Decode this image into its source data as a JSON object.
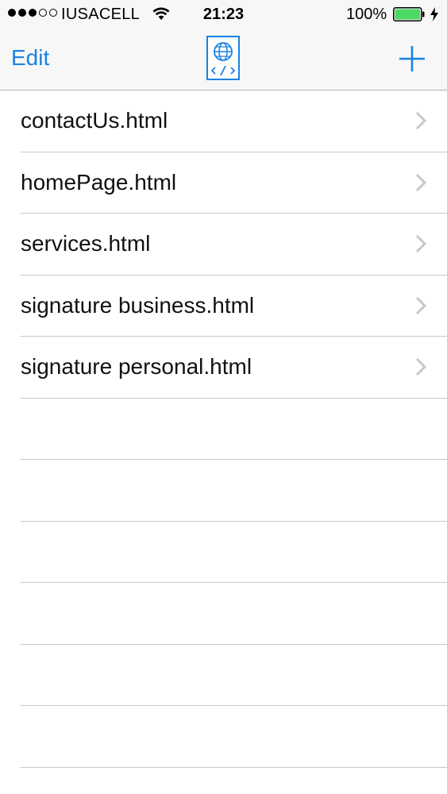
{
  "status_bar": {
    "carrier": "IUSACELL",
    "time": "21:23",
    "battery_percent": "100%",
    "signal_bars_filled": 3,
    "signal_bars_total": 5,
    "battery_color": "#4cd964"
  },
  "nav": {
    "edit_label": "Edit",
    "logo_icon": "html-globe-icon",
    "add_icon": "plus-icon",
    "accent_color": "#1a82e2"
  },
  "files": [
    {
      "label": "contactUs.html"
    },
    {
      "label": "homePage.html"
    },
    {
      "label": "services.html"
    },
    {
      "label": "signature business.html"
    },
    {
      "label": "signature personal.html"
    }
  ],
  "empty_rows": 6
}
